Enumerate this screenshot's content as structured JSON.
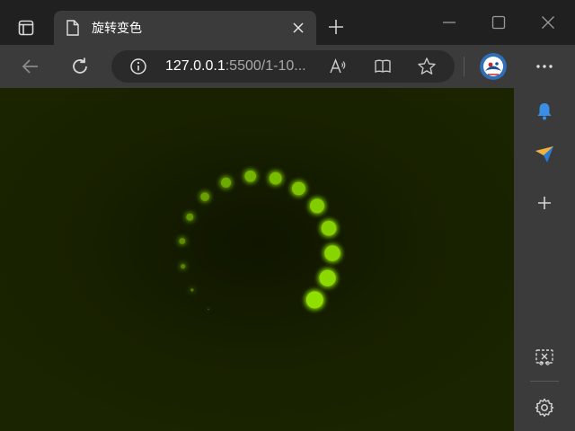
{
  "browser": {
    "tab": {
      "title": "旋转变色"
    },
    "address": {
      "host": "127.0.0.1",
      "path": ":5500/1-10..."
    }
  },
  "icons": {
    "tab_actions": "tab-actions-icon",
    "page": "document-icon",
    "close": "close-icon",
    "new_tab": "plus-icon",
    "minimize": "minimize-icon",
    "maximize": "maximize-icon",
    "window_close": "window-close-icon",
    "back": "back-arrow-icon",
    "refresh": "refresh-icon",
    "info": "info-icon",
    "read_aloud": "read-aloud-icon",
    "reader": "reader-mode-icon",
    "favorite": "star-icon",
    "more": "more-icon",
    "sidebar": [
      "bell-icon",
      "send-icon",
      "plus-icon",
      "screenshot-icon",
      "gear-icon"
    ]
  },
  "colors": {
    "page_background": "#182100",
    "dot": "#8fe000",
    "dot_glow": "#aaff00"
  },
  "animation": {
    "dot_count": 15,
    "scale_levels": [
      0.08,
      0.18,
      0.28,
      0.36,
      0.42,
      0.5,
      0.58,
      0.66,
      0.72,
      0.78,
      0.84,
      0.88,
      0.92,
      0.96,
      1.0
    ]
  }
}
